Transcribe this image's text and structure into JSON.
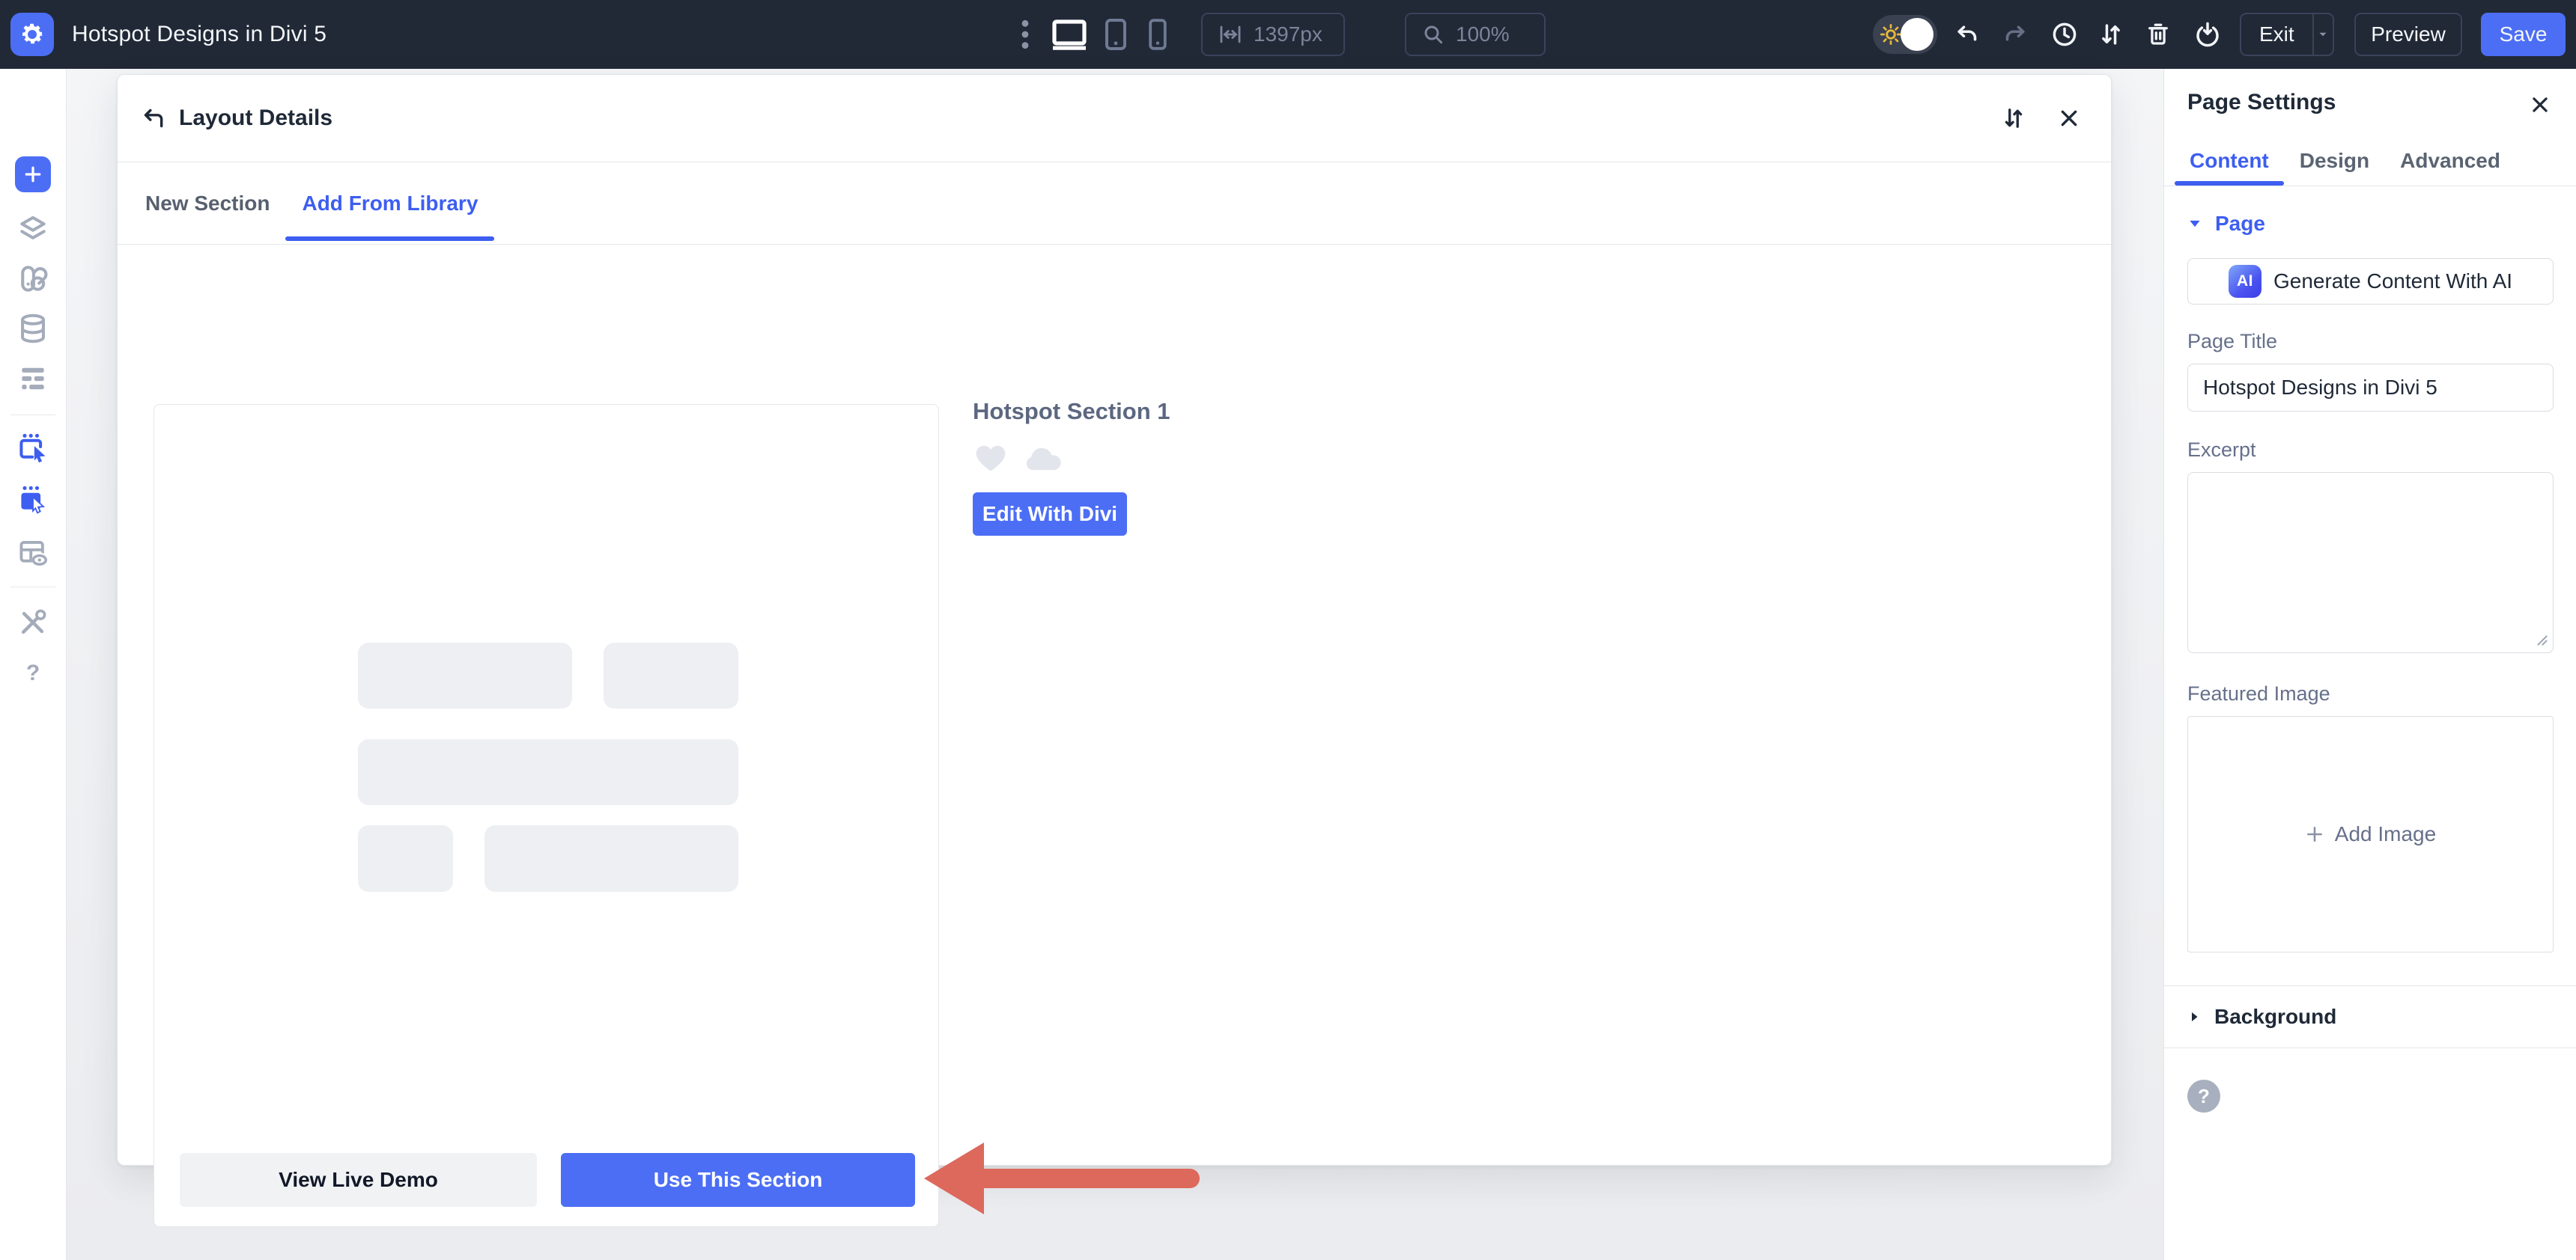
{
  "topbar": {
    "title": "Hotspot Designs in Divi 5",
    "width_value": "1397px",
    "zoom_value": "100%",
    "exit": "Exit",
    "preview": "Preview",
    "save": "Save"
  },
  "modal": {
    "title": "Layout Details",
    "tab_new_section": "New Section",
    "tab_add_from_library": "Add From Library",
    "section_name": "Hotspot Section 1",
    "edit_with_divi": "Edit With Divi",
    "view_live_demo": "View Live Demo",
    "use_this_section": "Use This Section"
  },
  "panel": {
    "title": "Page Settings",
    "tab_content": "Content",
    "tab_design": "Design",
    "tab_advanced": "Advanced",
    "section_page": "Page",
    "ai_badge": "AI",
    "ai_button": "Generate Content With AI",
    "page_title_label": "Page Title",
    "page_title_value": "Hotspot Designs in Divi 5",
    "excerpt_label": "Excerpt",
    "excerpt_value": "",
    "featured_image_label": "Featured Image",
    "add_image": "Add Image",
    "section_background": "Background"
  },
  "icons": {
    "help": "?"
  },
  "colors": {
    "accent_blue": "#4C6EF5",
    "link_blue": "#3D5EF0",
    "topbar_bg": "#212937",
    "annotation_arrow": "#DD685C",
    "skeleton_gray": "#EDEFF2",
    "sun_yellow": "#E7B83D"
  }
}
